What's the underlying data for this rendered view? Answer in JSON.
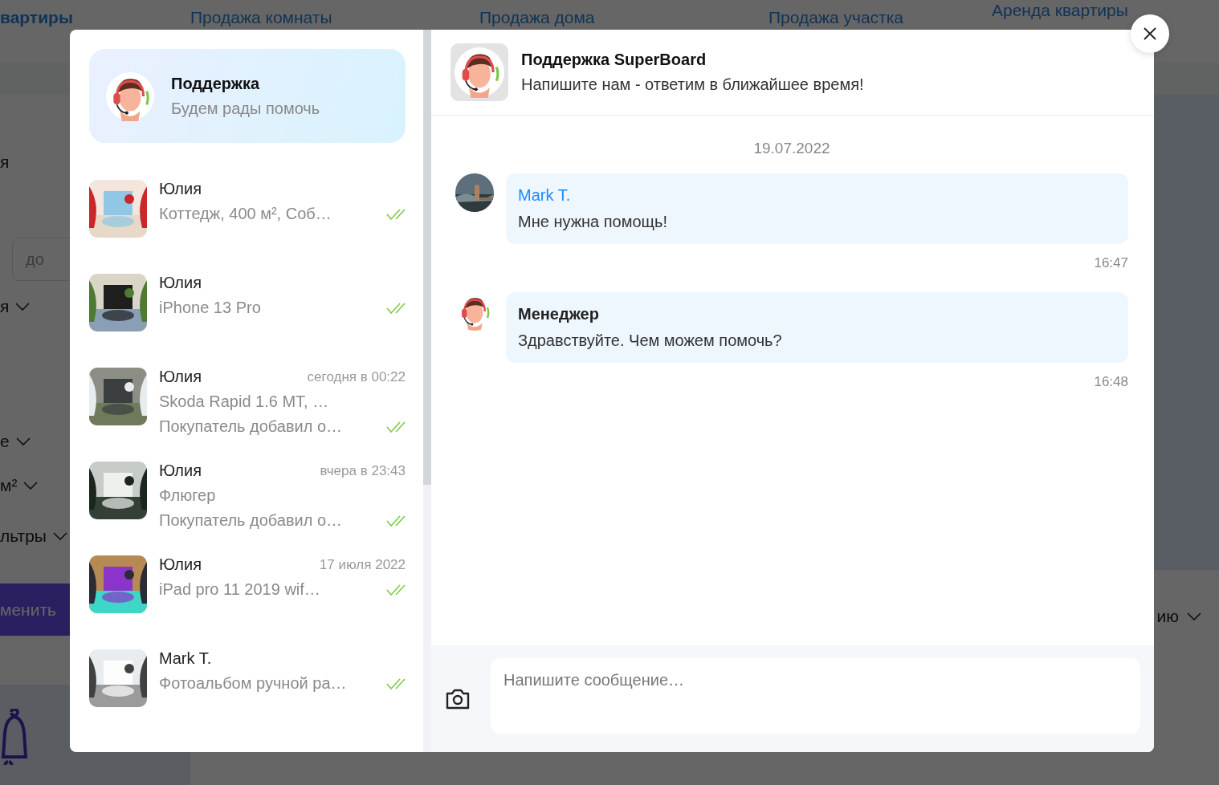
{
  "background": {
    "nav_tabs": [
      {
        "label": "вартиры",
        "selected": true
      },
      {
        "label": "Продажа комнаты",
        "selected": false
      },
      {
        "label": "Продажа дома",
        "selected": false
      },
      {
        "label": "Продажа участка",
        "selected": false
      },
      {
        "label": "Аренда квартиры",
        "selected": false
      }
    ],
    "filters": [
      {
        "kind": "text",
        "label": "я"
      },
      {
        "kind": "field",
        "placeholder": "до"
      },
      {
        "kind": "dropdown",
        "label": "я"
      },
      {
        "kind": "dropdown",
        "label": "е"
      },
      {
        "kind": "dropdown",
        "label": "м²"
      },
      {
        "kind": "dropdown",
        "label": "льтры"
      },
      {
        "kind": "button",
        "label": "менить"
      }
    ],
    "sort_dropdown": {
      "label": "ию"
    }
  },
  "chat_list": {
    "support": {
      "title": "Поддержка",
      "subtitle": "Будем рады помочь"
    },
    "items": [
      {
        "name": "Юлия",
        "title": "Коттедж, 400 м², Соб…",
        "read": true
      },
      {
        "name": "Юлия",
        "title": "iPhone 13 Pro",
        "read": true
      },
      {
        "name": "Юлия",
        "time": "сегодня в 00:22",
        "title": "Skoda Rapid 1.6 MT, …",
        "preview": "Покупатель добавил о…",
        "read": true
      },
      {
        "name": "Юлия",
        "time": "вчера в 23:43",
        "title": "Флюгер",
        "preview": "Покупатель добавил о…",
        "read": true
      },
      {
        "name": "Юлия",
        "time": "17 июля 2022",
        "title": "iPad pro 11 2019 wif…",
        "read": true
      },
      {
        "name": "Mark T.",
        "title": "Фотоальбом ручной ра…",
        "read": true
      }
    ]
  },
  "chat": {
    "header": {
      "title": "Поддержка SuperBoard",
      "subtitle": "Напишите нам - ответим в ближайшее время!"
    },
    "date": "19.07.2022",
    "messages": [
      {
        "kind": "user",
        "author": "Mark T.",
        "text": "Мне нужна помощь!",
        "time": "16:47"
      },
      {
        "kind": "manager",
        "author": "Менеджер",
        "text": "Здравствуйте. Чем можем помочь?",
        "time": "16:48"
      }
    ],
    "composer": {
      "placeholder": "Напишите сообщение…"
    }
  }
}
